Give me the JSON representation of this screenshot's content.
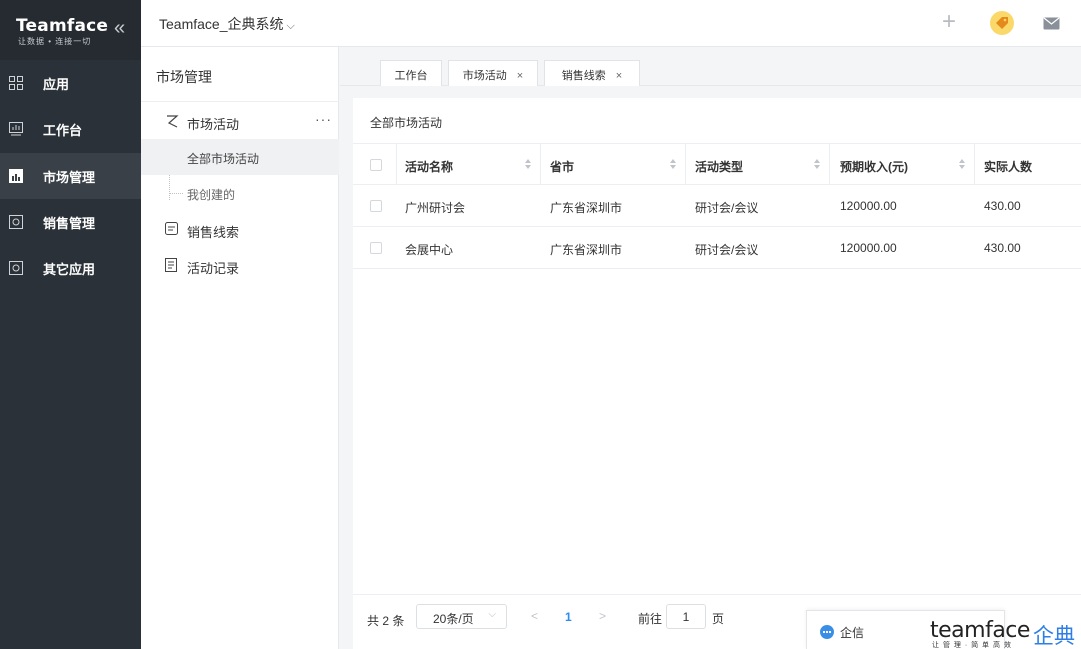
{
  "brand": {
    "name": "Teamface",
    "slogan": "让数据 • 连接一切"
  },
  "nav": {
    "items": [
      {
        "label": "应用",
        "icon": "apps-icon"
      },
      {
        "label": "工作台",
        "icon": "workbench-icon"
      },
      {
        "label": "市场管理",
        "icon": "market-icon",
        "active": true
      },
      {
        "label": "销售管理",
        "icon": "sales-icon"
      },
      {
        "label": "其它应用",
        "icon": "other-apps-icon"
      }
    ]
  },
  "topbar": {
    "system_title": "Teamface_企典系统",
    "chevron": "⌵"
  },
  "subnav": {
    "title": "市场管理",
    "groups": [
      {
        "label": "市场活动",
        "more": "···",
        "children": [
          {
            "label": "全部市场活动",
            "active": true
          },
          {
            "label": "我创建的"
          }
        ]
      },
      {
        "label": "销售线索"
      },
      {
        "label": "活动记录"
      }
    ]
  },
  "tabs": [
    {
      "label": "工作台",
      "closable": false
    },
    {
      "label": "市场活动",
      "closable": true,
      "active": true
    },
    {
      "label": "销售线索",
      "closable": true
    }
  ],
  "tab_close": "×",
  "main": {
    "breadcrumb": "全部市场活动",
    "columns": [
      "活动名称",
      "省市",
      "活动类型",
      "预期收入(元)",
      "实际人数"
    ],
    "rows": [
      [
        "广州研讨会",
        "广东省深圳市",
        "研讨会/会议",
        "120000.00",
        "430.00"
      ],
      [
        "会展中心",
        "广东省深圳市",
        "研讨会/会议",
        "120000.00",
        "430.00"
      ]
    ]
  },
  "pager": {
    "total": "共 2 条",
    "page_size": "20条/页",
    "prev": "<",
    "current": "1",
    "next": ">",
    "goto_prefix": "前往",
    "goto_value": "1",
    "goto_suffix": "页"
  },
  "chat": {
    "label": "企信"
  },
  "watermark": {
    "en": "teamface",
    "sub": "让 管 理 · 简 单 高 效",
    "cn": "企典"
  },
  "colors": {
    "nav_bg": "#2b3138",
    "accent": "#2d8cf0",
    "tag_yellow": "#fbd86a"
  }
}
